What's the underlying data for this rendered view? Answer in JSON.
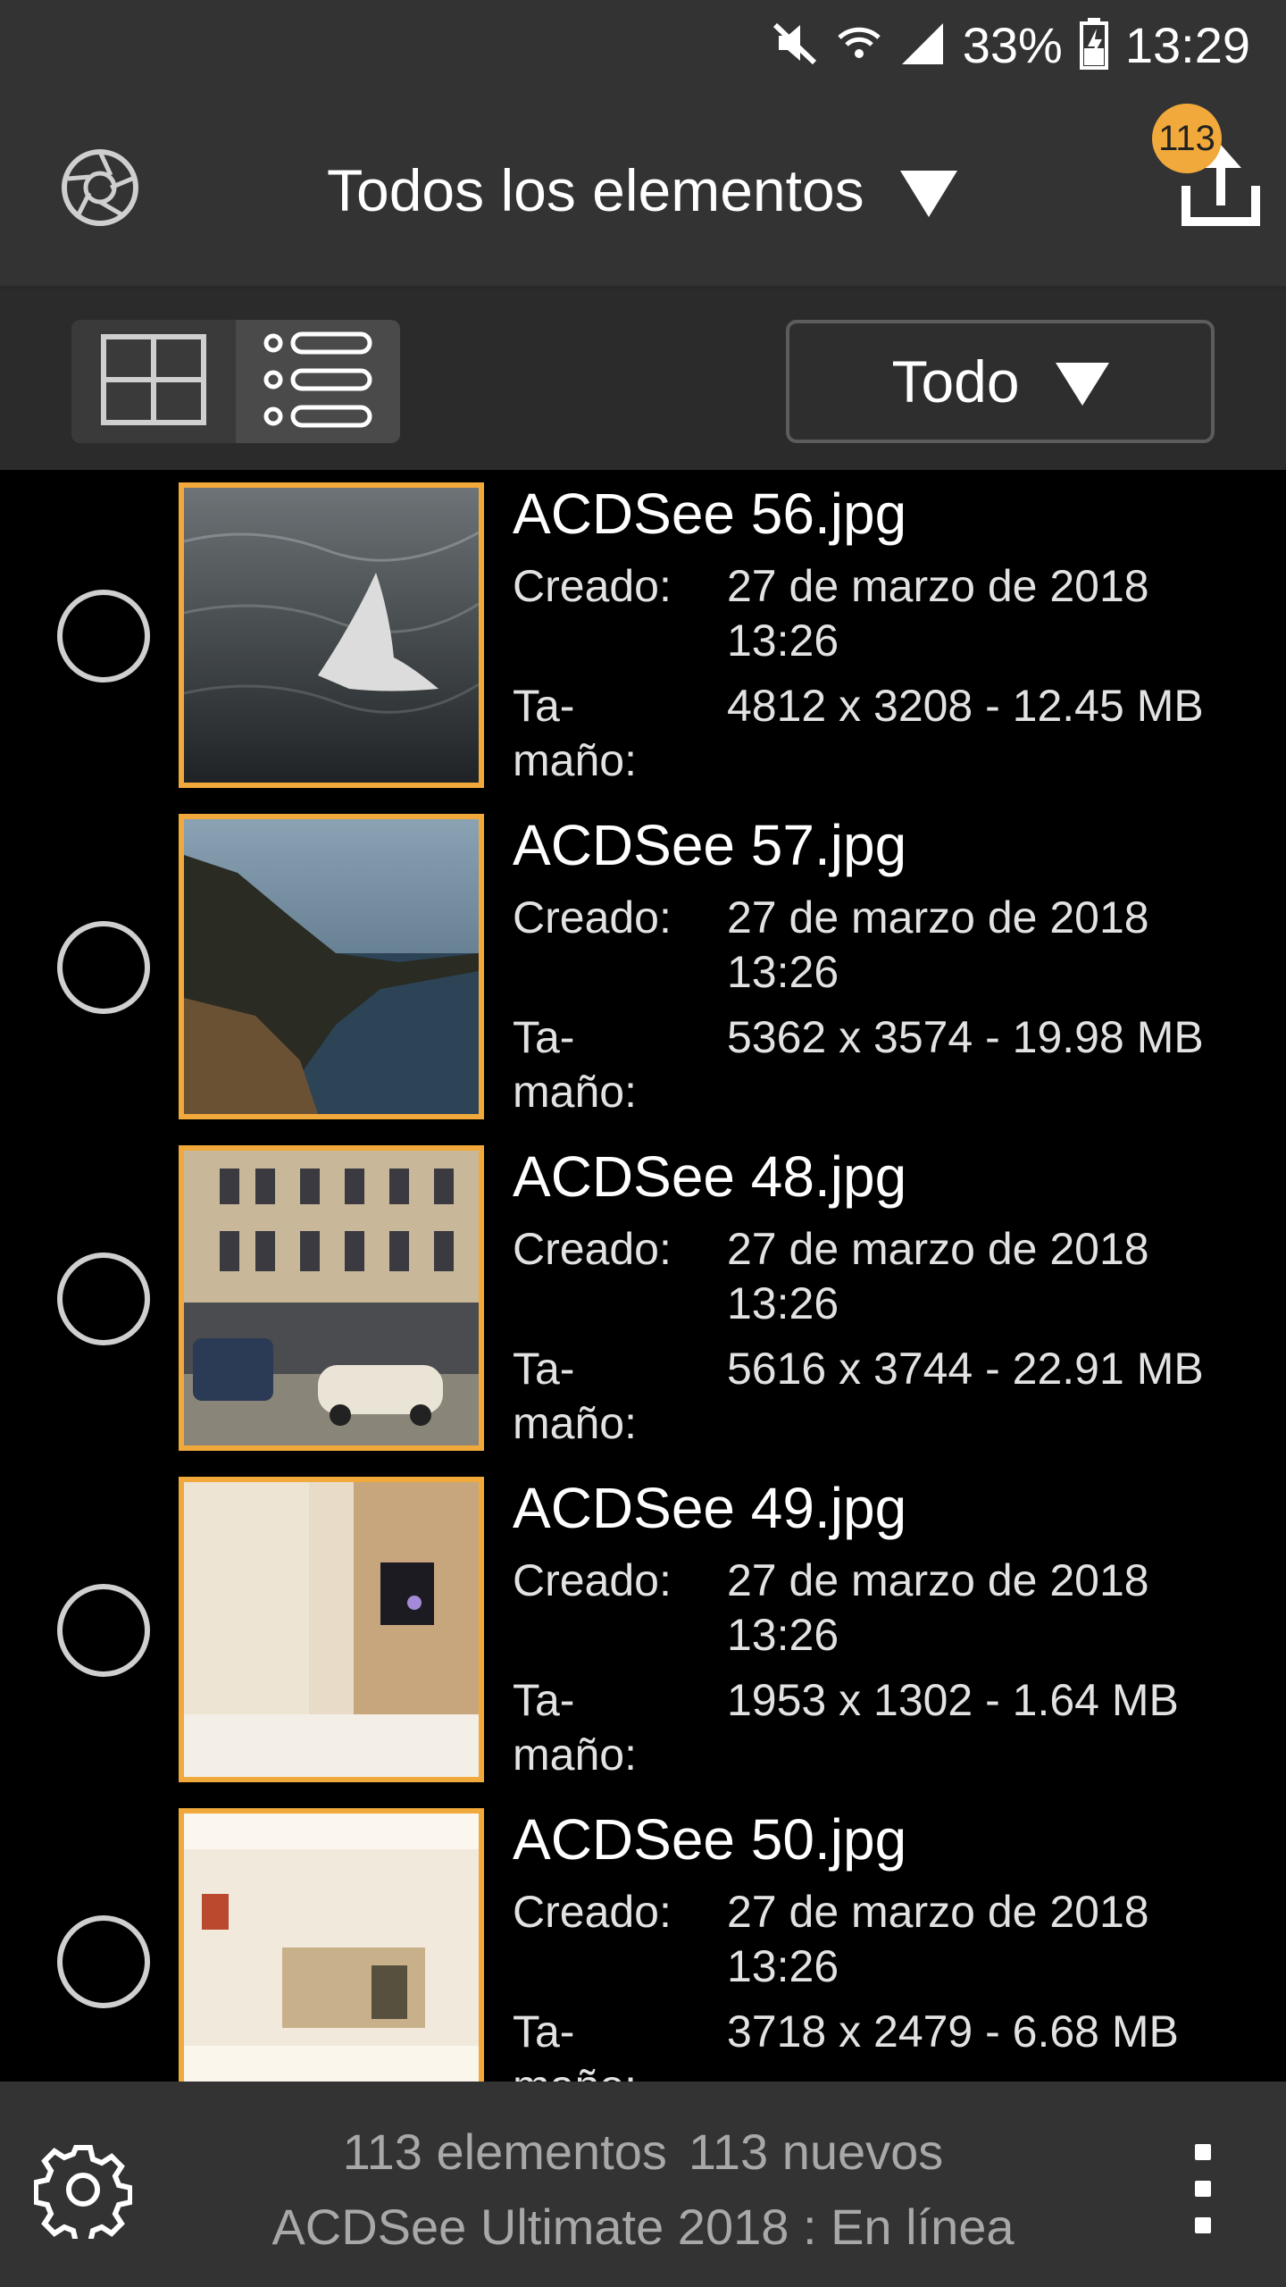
{
  "status_bar": {
    "battery": "33%",
    "time": "13:29"
  },
  "app_bar": {
    "title": "Todos los elementos",
    "badge_count": "113"
  },
  "toolbar": {
    "filter_label": "Todo"
  },
  "labels": {
    "created": "Creado:",
    "size_line1": "Ta-",
    "size_line2": "maño:"
  },
  "items": [
    {
      "name": "ACDSee 56.jpg",
      "created_date": "27 de marzo de 2018",
      "created_time": "13:26",
      "size": "4812 x 3208 - 12.45 MB"
    },
    {
      "name": "ACDSee 57.jpg",
      "created_date": "27 de marzo de 2018",
      "created_time": "13:26",
      "size": "5362 x 3574 - 19.98 MB"
    },
    {
      "name": "ACDSee 48.jpg",
      "created_date": "27 de marzo de 2018",
      "created_time": "13:26",
      "size": "5616 x 3744 - 22.91 MB"
    },
    {
      "name": "ACDSee 49.jpg",
      "created_date": "27 de marzo de 2018",
      "created_time": "13:26",
      "size": "1953 x 1302 - 1.64 MB"
    },
    {
      "name": "ACDSee 50.jpg",
      "created_date": "27 de marzo de 2018",
      "created_time": "13:26",
      "size": "3718 x 2479 - 6.68 MB"
    }
  ],
  "bottom_bar": {
    "count_label": "113 elementos",
    "new_label": "113 nuevos",
    "status_line": "ACDSee Ultimate 2018 : En línea"
  },
  "colors": {
    "accent": "#f0a93a",
    "bar_bg": "#333333",
    "list_bg": "#000000"
  },
  "icons": [
    "mute-icon",
    "wifi-icon",
    "signal-icon",
    "battery-icon",
    "aperture-icon",
    "upload-icon",
    "grid-view-icon",
    "list-view-icon",
    "settings-icon",
    "more-vert-icon"
  ]
}
